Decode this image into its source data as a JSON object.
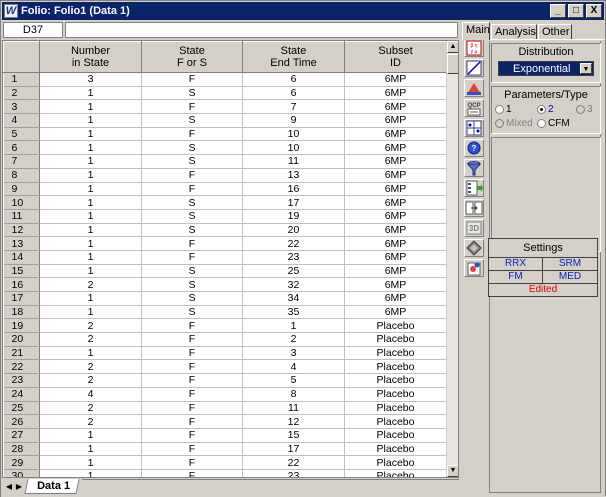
{
  "window": {
    "title": "Folio: Folio1 (Data 1)",
    "app_icon_letter": "W",
    "buttons": {
      "minimize": "_",
      "maximize": "□",
      "close": "X"
    }
  },
  "formula_bar": {
    "cell_ref": "D37",
    "value": ""
  },
  "grid": {
    "columns": [
      {
        "label": "Number\nin State"
      },
      {
        "label": "State\nF or S"
      },
      {
        "label": "State\nEnd Time"
      },
      {
        "label": "Subset\nID"
      }
    ],
    "rows": [
      [
        "1",
        "3",
        "F",
        "6",
        "6MP"
      ],
      [
        "2",
        "1",
        "S",
        "6",
        "6MP"
      ],
      [
        "3",
        "1",
        "F",
        "7",
        "6MP"
      ],
      [
        "4",
        "1",
        "S",
        "9",
        "6MP"
      ],
      [
        "5",
        "1",
        "F",
        "10",
        "6MP"
      ],
      [
        "6",
        "1",
        "S",
        "10",
        "6MP"
      ],
      [
        "7",
        "1",
        "S",
        "11",
        "6MP"
      ],
      [
        "8",
        "1",
        "F",
        "13",
        "6MP"
      ],
      [
        "9",
        "1",
        "F",
        "16",
        "6MP"
      ],
      [
        "10",
        "1",
        "S",
        "17",
        "6MP"
      ],
      [
        "11",
        "1",
        "S",
        "19",
        "6MP"
      ],
      [
        "12",
        "1",
        "S",
        "20",
        "6MP"
      ],
      [
        "13",
        "1",
        "F",
        "22",
        "6MP"
      ],
      [
        "14",
        "1",
        "F",
        "23",
        "6MP"
      ],
      [
        "15",
        "1",
        "S",
        "25",
        "6MP"
      ],
      [
        "16",
        "2",
        "S",
        "32",
        "6MP"
      ],
      [
        "17",
        "1",
        "S",
        "34",
        "6MP"
      ],
      [
        "18",
        "1",
        "S",
        "35",
        "6MP"
      ],
      [
        "19",
        "2",
        "F",
        "1",
        "Placebo"
      ],
      [
        "20",
        "2",
        "F",
        "2",
        "Placebo"
      ],
      [
        "21",
        "1",
        "F",
        "3",
        "Placebo"
      ],
      [
        "22",
        "2",
        "F",
        "4",
        "Placebo"
      ],
      [
        "23",
        "2",
        "F",
        "5",
        "Placebo"
      ],
      [
        "24",
        "4",
        "F",
        "8",
        "Placebo"
      ],
      [
        "25",
        "2",
        "F",
        "11",
        "Placebo"
      ],
      [
        "26",
        "2",
        "F",
        "12",
        "Placebo"
      ],
      [
        "27",
        "1",
        "F",
        "15",
        "Placebo"
      ],
      [
        "28",
        "1",
        "F",
        "17",
        "Placebo"
      ],
      [
        "29",
        "1",
        "F",
        "22",
        "Placebo"
      ],
      [
        "30",
        "1",
        "F",
        "23",
        "Placebo"
      ]
    ]
  },
  "sheet_tabs": [
    {
      "label": "Data 1",
      "active": true
    }
  ],
  "right_tabs": [
    {
      "label": "Main",
      "active": true
    },
    {
      "label": "Analysis",
      "active": false
    },
    {
      "label": "Other",
      "active": false
    }
  ],
  "distribution": {
    "title": "Distribution",
    "selected": "Exponential"
  },
  "parameters": {
    "title": "Parameters/Type",
    "options": [
      {
        "label": "1",
        "checked": false,
        "disabled": false
      },
      {
        "label": "2",
        "checked": true,
        "disabled": false
      },
      {
        "label": "3",
        "checked": false,
        "disabled": true
      },
      {
        "label": "Mixed",
        "checked": false,
        "disabled": true
      },
      {
        "label": "CFM",
        "checked": false,
        "disabled": false
      }
    ]
  },
  "settings": {
    "title": "Settings",
    "items": [
      "RRX",
      "SRM",
      "FM",
      "MED"
    ],
    "status": "Edited"
  },
  "icons": [
    "calculate-icon",
    "plot-icon",
    "quick-plot-icon",
    "qcp-icon",
    "batch-auto-run-icon",
    "info-icon",
    "filter-icon",
    "data-type-icon",
    "transfer-icon",
    "3d-plot-icon",
    "rank-icon",
    "add-folio-icon"
  ],
  "colors": {
    "titlebar": "#0a246a",
    "selection": "#0a246a",
    "settings_link": "#1020c0",
    "edited": "#e00000"
  }
}
